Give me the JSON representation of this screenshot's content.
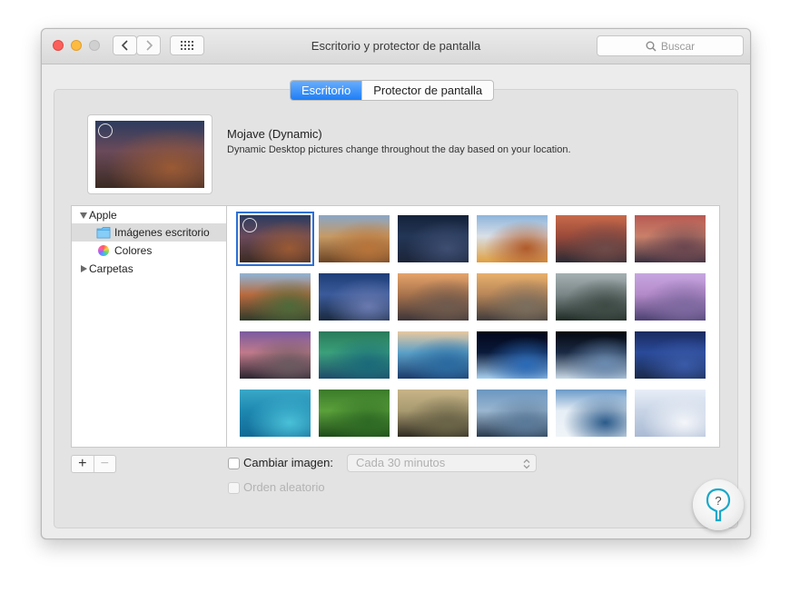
{
  "window": {
    "title": "Escritorio y protector de pantalla",
    "search_placeholder": "Buscar"
  },
  "tabs": [
    {
      "label": "Escritorio",
      "active": true
    },
    {
      "label": "Protector de pantalla",
      "active": false
    }
  ],
  "current_wallpaper": {
    "name": "Mojave (Dynamic)",
    "description": "Dynamic Desktop pictures change throughout the day based on your location."
  },
  "sources": {
    "apple": {
      "label": "Apple",
      "expanded": true
    },
    "imagenes": {
      "label": "Imágenes escritorio",
      "selected": true,
      "icon": "folder-icon"
    },
    "colores": {
      "label": "Colores",
      "icon": "color-wheel-icon"
    },
    "carpetas": {
      "label": "Carpetas",
      "expanded": false
    }
  },
  "thumbnails": [
    {
      "name": "mojave-dynamic",
      "g": [
        "#2b3b5e",
        "#6a4a5a",
        "#9a5a34",
        "#3b2a22"
      ],
      "selected": true,
      "dynamic": true
    },
    {
      "name": "mojave-day",
      "g": [
        "#8aa6c6",
        "#c79a64",
        "#b8743a",
        "#6b4324"
      ]
    },
    {
      "name": "mojave-night",
      "g": [
        "#15223a",
        "#233656",
        "#3e4e72",
        "#1c2438"
      ]
    },
    {
      "name": "high-sierra",
      "g": [
        "#8db5dc",
        "#d9dfe6",
        "#b05a2a",
        "#e0a040"
      ]
    },
    {
      "name": "sierra",
      "g": [
        "#c86a4a",
        "#9a4a3a",
        "#6e4a48",
        "#2a2a34"
      ]
    },
    {
      "name": "sierra-2",
      "g": [
        "#b75a52",
        "#c9806a",
        "#6a4650",
        "#3a3040"
      ]
    },
    {
      "name": "el-capitan",
      "g": [
        "#8fb4d6",
        "#b86a3e",
        "#4e6a3a",
        "#2e3a2a"
      ]
    },
    {
      "name": "el-capitan-2",
      "g": [
        "#1e3e78",
        "#3a5a9a",
        "#6a7ab0",
        "#1a2a3e"
      ]
    },
    {
      "name": "yosemite",
      "g": [
        "#e6a46a",
        "#a8734c",
        "#6e5a4e",
        "#3a3438"
      ]
    },
    {
      "name": "yosemite-2",
      "g": [
        "#e8b06c",
        "#b88658",
        "#7a6e5e",
        "#3e3a3a"
      ]
    },
    {
      "name": "yosemite-3",
      "g": [
        "#a4b0b2",
        "#7a8686",
        "#3e4a44",
        "#1e2a24"
      ]
    },
    {
      "name": "yosemite-4",
      "g": [
        "#c6a6e0",
        "#b48ac8",
        "#7e6aa0",
        "#4a4070"
      ]
    },
    {
      "name": "yosemite-5",
      "g": [
        "#7a5aa0",
        "#c07a8a",
        "#6a5a60",
        "#2a2430"
      ]
    },
    {
      "name": "wave-green",
      "g": [
        "#2a7a5a",
        "#3aa07a",
        "#1a6a7a",
        "#1e4a6a"
      ]
    },
    {
      "name": "wave-blue",
      "g": [
        "#e8c8a0",
        "#5aa0c8",
        "#2a6aa0",
        "#1a3a6a"
      ]
    },
    {
      "name": "earth-horizon",
      "g": [
        "#02061a",
        "#0a1a3a",
        "#2a6ab8",
        "#a8d0f0"
      ]
    },
    {
      "name": "earth-orbit",
      "g": [
        "#040810",
        "#1a2a44",
        "#6a8ab0",
        "#c8d8e6"
      ]
    },
    {
      "name": "milky-way",
      "g": [
        "#1a2a5e",
        "#2a4a9a",
        "#3a5aa8",
        "#1a2a4a"
      ]
    },
    {
      "name": "blue-water",
      "g": [
        "#3aa8c8",
        "#1e88b0",
        "#4ac0d8",
        "#126a96"
      ]
    },
    {
      "name": "rice-fields",
      "g": [
        "#3a7a2a",
        "#5aa03a",
        "#2e6a24",
        "#1e4a1a"
      ]
    },
    {
      "name": "foggy-forest",
      "g": [
        "#c8b488",
        "#a89a70",
        "#6a6448",
        "#2e2a20"
      ]
    },
    {
      "name": "mountain-mist",
      "g": [
        "#6a96c0",
        "#9ab6d0",
        "#5a7a9a",
        "#2a3a4e"
      ]
    },
    {
      "name": "frozen-lake",
      "g": [
        "#6a9ac8",
        "#e6eef6",
        "#2a5a8a",
        "#f0f4f8"
      ]
    },
    {
      "name": "snow-dunes",
      "g": [
        "#e8eef8",
        "#c8d4e6",
        "#f4f6fa",
        "#aabad4"
      ]
    }
  ],
  "controls": {
    "plus": "+",
    "minus": "−",
    "change_picture_label": "Cambiar imagen:",
    "interval_value": "Cada 30 minutos",
    "random_order_label": "Orden aleatorio",
    "help_symbol": "?"
  },
  "colors": {
    "accent": "#1e7ef6",
    "selection": "#2c6fd6",
    "help_accent": "#1aa8c8"
  }
}
